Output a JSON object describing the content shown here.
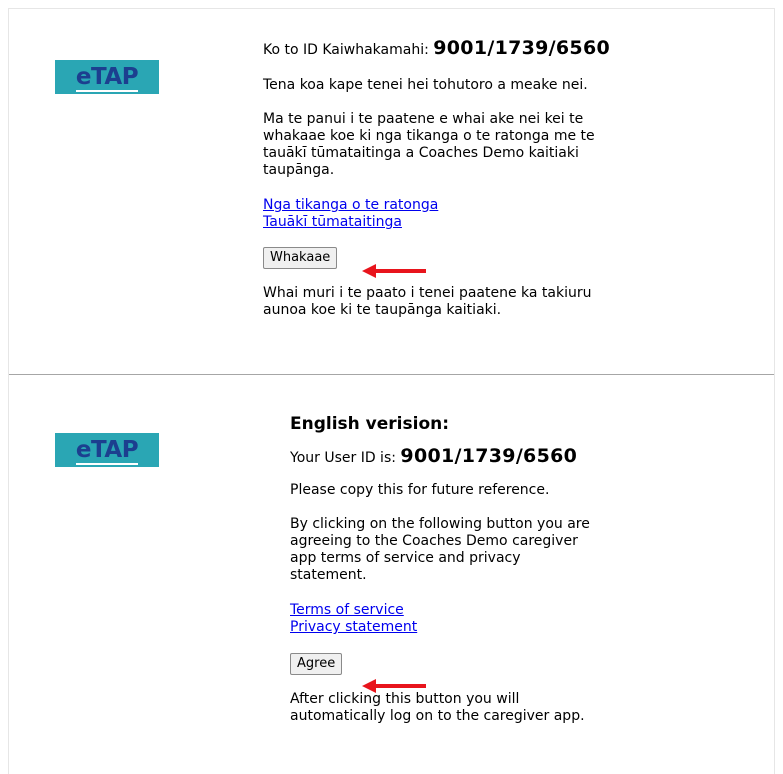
{
  "maori": {
    "logo_text": "eTAP",
    "id_label": "Ko to ID Kaiwhakamahi:",
    "id_value": "9001/1739/6560",
    "copy_note": "Tena koa kape tenei hei tohutoro a meake nei.",
    "agreement_text": "Ma te panui i te paatene e whai ake nei kei te whakaae koe ki nga tikanga o te ratonga me te tauākī tūmataitinga a Coaches Demo kaitiaki taupānga.",
    "terms_link": "Nga tikanga o te ratonga",
    "privacy_link": "Tauākī tūmataitinga",
    "button_label": "Whakaae",
    "after_text": "Whai muri i te paato i tenei paatene ka takiuru aunoa koe ki te taupānga kaitiaki."
  },
  "english": {
    "logo_text": "eTAP",
    "heading": "English verision:",
    "id_label": "Your User ID is:",
    "id_value": "9001/1739/6560",
    "copy_note": "Please copy this for future reference.",
    "agreement_text": "By clicking on the following button you are agreeing to the Coaches Demo caregiver app terms of service and privacy statement.",
    "terms_link": "Terms of service",
    "privacy_link": "Privacy statement",
    "button_label": "Agree",
    "after_text": "After clicking this button you will automatically log on to the caregiver app."
  },
  "colors": {
    "logo_bg": "#2aa6b4",
    "logo_text": "#1c3f8f",
    "link": "#0000ee",
    "arrow": "#e8141c"
  },
  "icons": {
    "arrow": "red-left-arrow-icon"
  }
}
